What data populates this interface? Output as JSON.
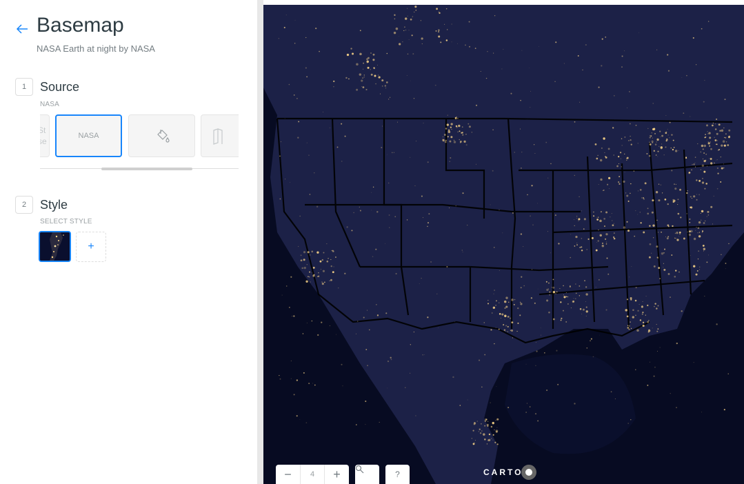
{
  "panel": {
    "title": "Basemap",
    "subtitle": "NASA Earth at night by NASA",
    "back_icon": "arrow-left-icon"
  },
  "steps": [
    {
      "number": "1",
      "title": "Source",
      "caption": "NASA",
      "sources": [
        {
          "label": "St\nse",
          "selected": false
        },
        {
          "label": "NASA",
          "selected": true
        },
        {
          "label": "",
          "icon": "paint-bucket-icon",
          "selected": false
        },
        {
          "label": "",
          "icon": "map-fold-icon",
          "selected": false
        }
      ]
    },
    {
      "number": "2",
      "title": "Style",
      "caption": "SELECT STYLE",
      "add_label": "+"
    }
  ],
  "map": {
    "zoom_out": "−",
    "zoom_level": "4",
    "zoom_in": "+",
    "search_icon": "search-icon",
    "help_label": "?",
    "attribution": "CARTO"
  },
  "colors": {
    "accent": "#1785fb",
    "map_bg": "#0b1030",
    "lights": "#ffd98a"
  }
}
